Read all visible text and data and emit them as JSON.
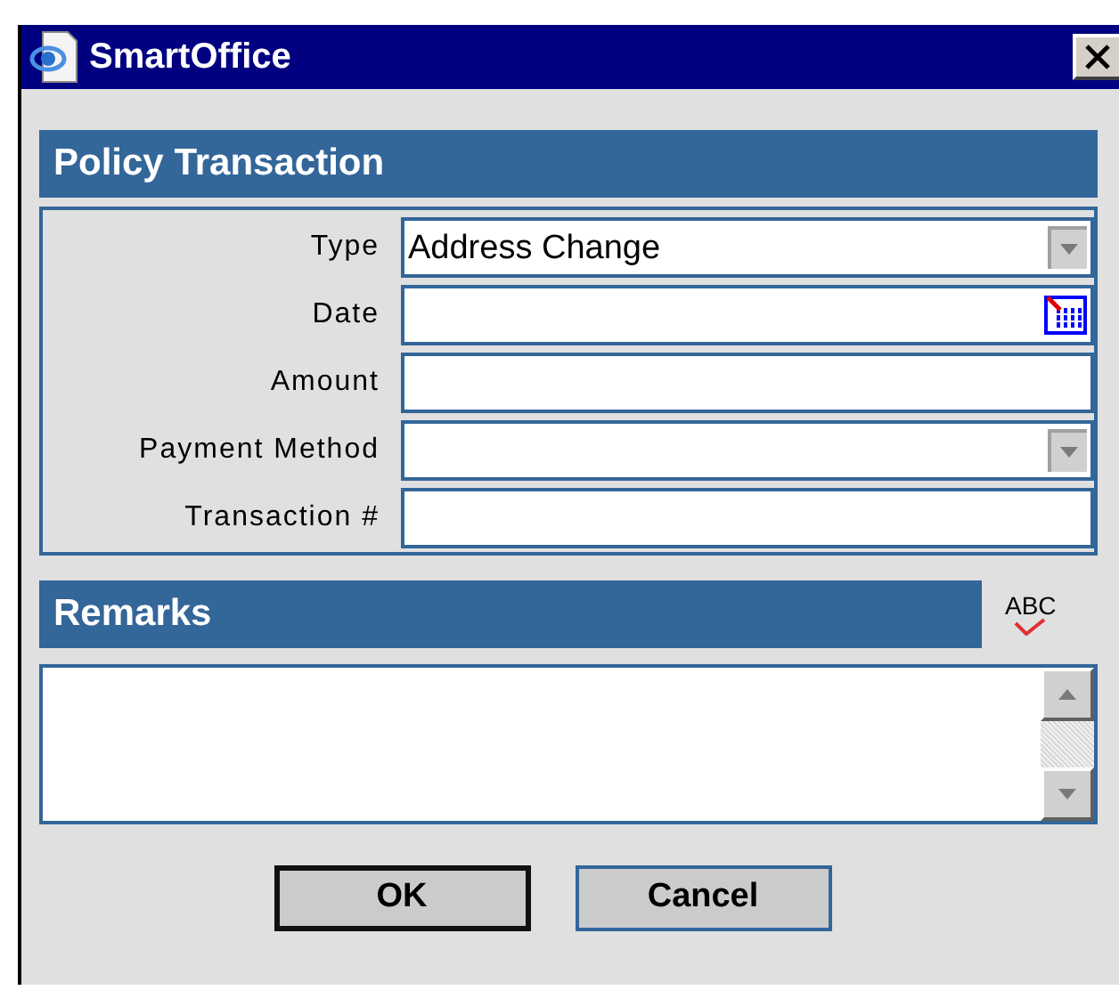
{
  "window": {
    "title": "SmartOffice"
  },
  "section": {
    "title": "Policy Transaction"
  },
  "fields": [
    {
      "label": "Type",
      "kind": "select",
      "value": "Address Change"
    },
    {
      "label": "Date",
      "kind": "date"
    },
    {
      "label": "Amount",
      "kind": "text"
    },
    {
      "label": "Payment Method",
      "kind": "select"
    },
    {
      "label": "Transaction #",
      "kind": "text"
    }
  ],
  "remarks": {
    "title": "Remarks",
    "spellcheck": "ABC"
  },
  "buttons": [
    {
      "label": "OK",
      "default": true
    },
    {
      "label": "Cancel",
      "default": false
    }
  ]
}
